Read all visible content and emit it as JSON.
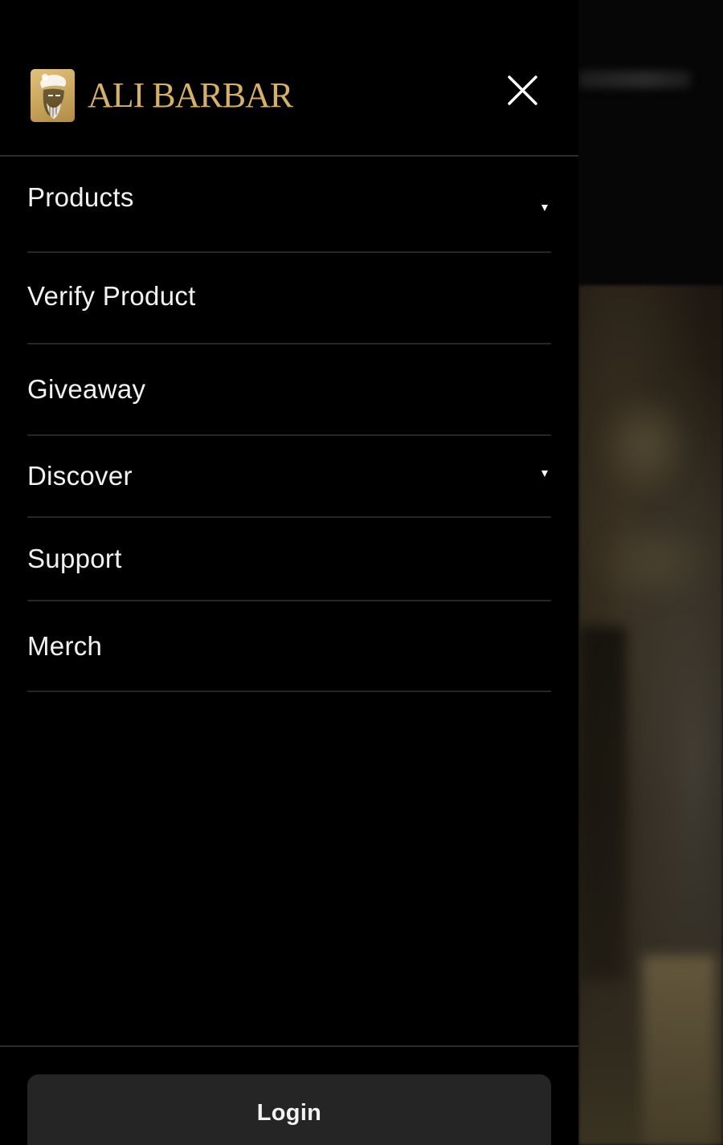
{
  "brand": {
    "name": "ALI BARBAR",
    "logo_icon": "turbaned-man-icon",
    "color": "#d4b06a"
  },
  "drawer": {
    "close_icon": "close-icon",
    "menu_items": [
      {
        "label": "Products",
        "has_dropdown": true
      },
      {
        "label": "Verify Product",
        "has_dropdown": false
      },
      {
        "label": "Giveaway",
        "has_dropdown": false
      },
      {
        "label": "Discover",
        "has_dropdown": true
      },
      {
        "label": "Support",
        "has_dropdown": false
      },
      {
        "label": "Merch",
        "has_dropdown": false
      }
    ],
    "login_label": "Login"
  },
  "colors": {
    "background": "#000000",
    "divider": "#262626",
    "login_button": "#252525",
    "text": "#f2f2f2"
  }
}
